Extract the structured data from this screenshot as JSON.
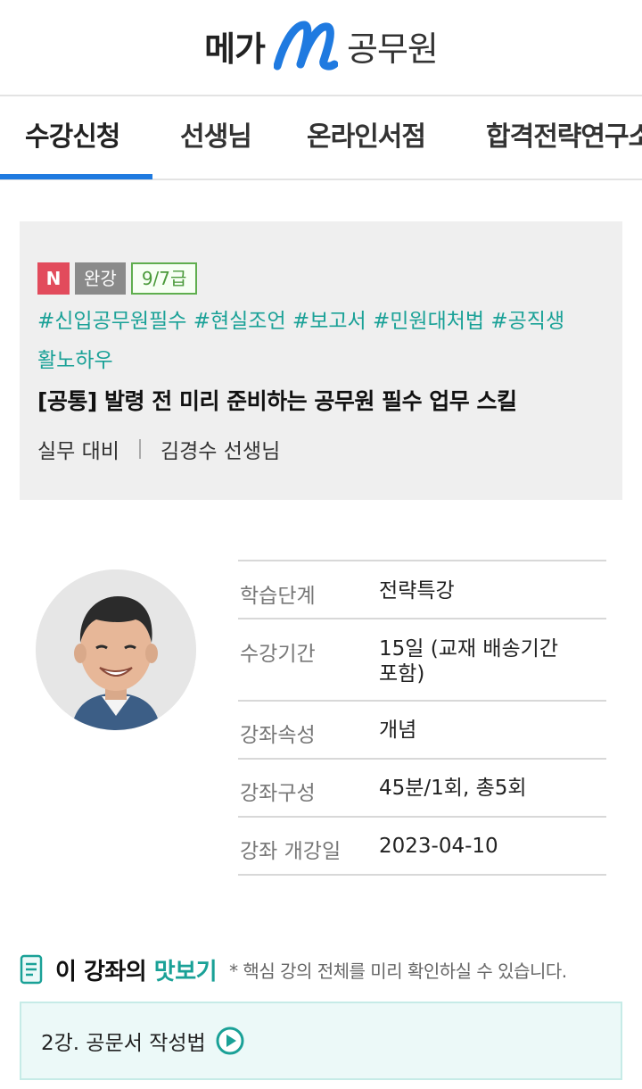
{
  "header": {
    "logo_left": "메가",
    "logo_right": "공무원",
    "logo_mark_icon": "mega-m-logo-icon"
  },
  "tabs": [
    {
      "label": "수강신청",
      "active": true
    },
    {
      "label": "선생님",
      "active": false
    },
    {
      "label": "온라인서점",
      "active": false
    },
    {
      "label": "합격전략연구소",
      "active": false
    }
  ],
  "course": {
    "badge_new": "N",
    "badge_status": "완강",
    "badge_grade": "9/7급",
    "tags": "#신입공무원필수 #현실조언 #보고서 #민원대처법 #공직생활노하우",
    "title": "[공통] 발령 전 미리 준비하는 공무원 필수 업무 스킬",
    "category": "실무 대비",
    "teacher": "김경수 선생님"
  },
  "details": [
    {
      "label": "학습단계",
      "value": "전략특강"
    },
    {
      "label": "수강기간",
      "value": "15일 (교재 배송기간 포함)"
    },
    {
      "label": "강좌속성",
      "value": "개념"
    },
    {
      "label": "강좌구성",
      "value": "45분/1회, 총5회"
    },
    {
      "label": "강좌 개강일",
      "value": "2023-04-10"
    }
  ],
  "preview": {
    "title_prefix": "이 강좌의 ",
    "title_highlight": "맛보기",
    "note": "* 핵심 강의 전체를 미리 확인하실 수 있습니다.",
    "item_label": "2강. 공문서 작성법",
    "icon": "document-list-icon",
    "play_icon": "play-circle-icon"
  },
  "colors": {
    "accent_blue": "#1f7ae0",
    "teal": "#1aa197",
    "badge_new": "#e24b5c",
    "badge_status": "#8a8a8a",
    "badge_grade": "#5fae4e"
  }
}
